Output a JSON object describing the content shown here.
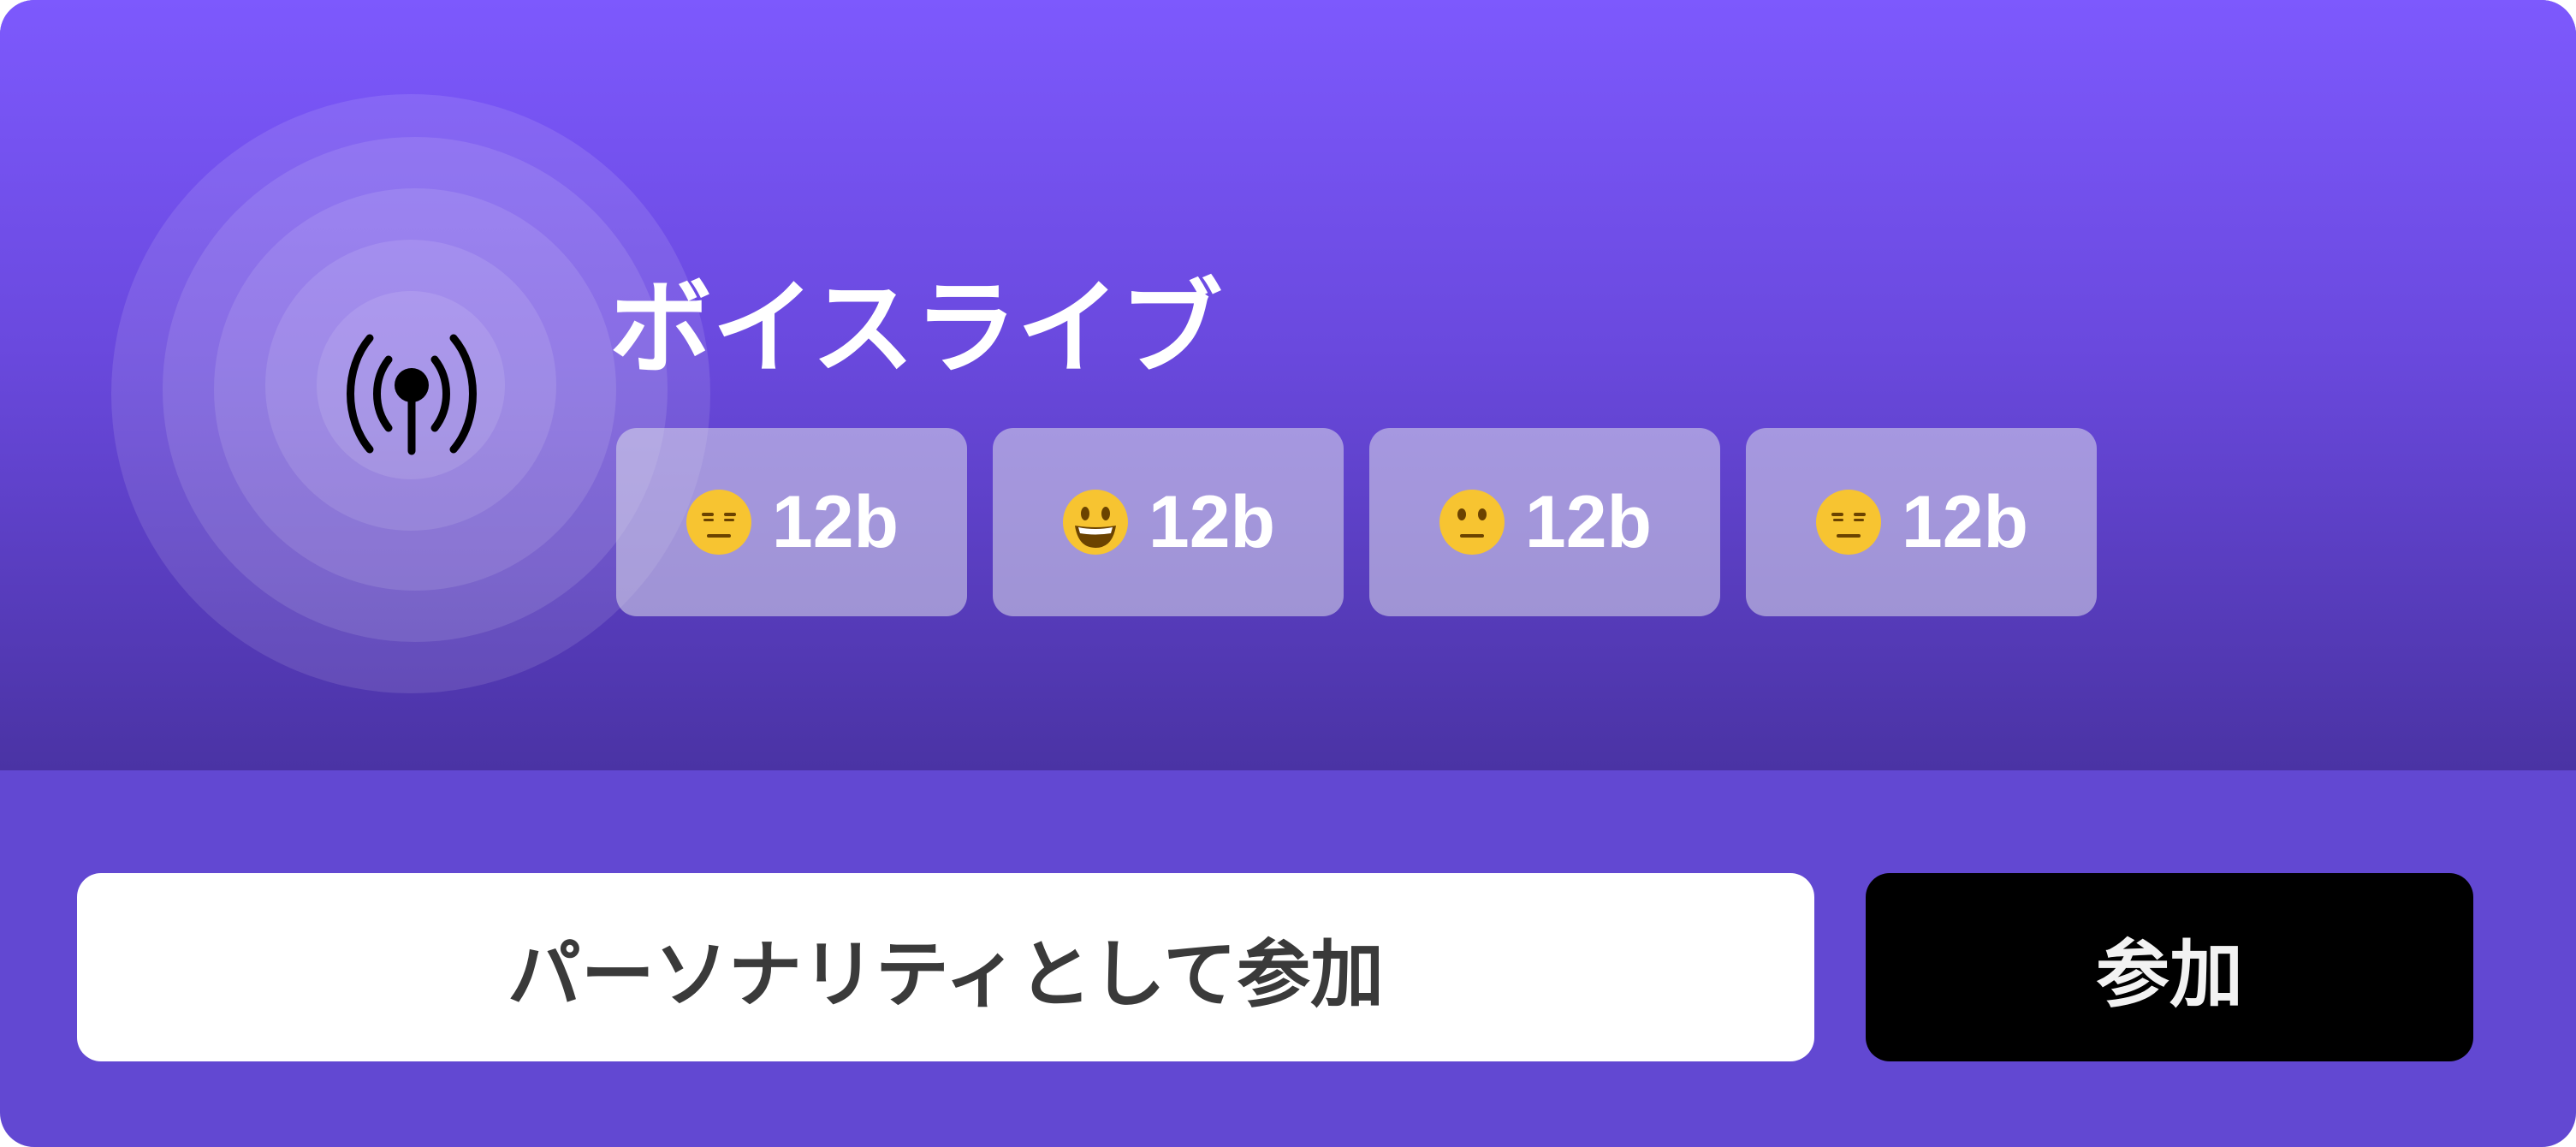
{
  "header": {
    "title": "ボイスライブ",
    "icon": "broadcast-antenna-icon"
  },
  "reactions": [
    {
      "emoji": "expressionless-face",
      "count": "12b"
    },
    {
      "emoji": "grinning-face",
      "count": "12b"
    },
    {
      "emoji": "neutral-face",
      "count": "12b"
    },
    {
      "emoji": "expressionless-face",
      "count": "12b"
    }
  ],
  "actions": {
    "join_as_personality_label": "パーソナリティとして参加",
    "join_label": "参加"
  },
  "colors": {
    "accent": "#6248d2",
    "gradient_top": "#7d59fd",
    "gradient_bottom": "#4a33a4",
    "primary_button": "#000000",
    "secondary_button": "#ffffff"
  }
}
